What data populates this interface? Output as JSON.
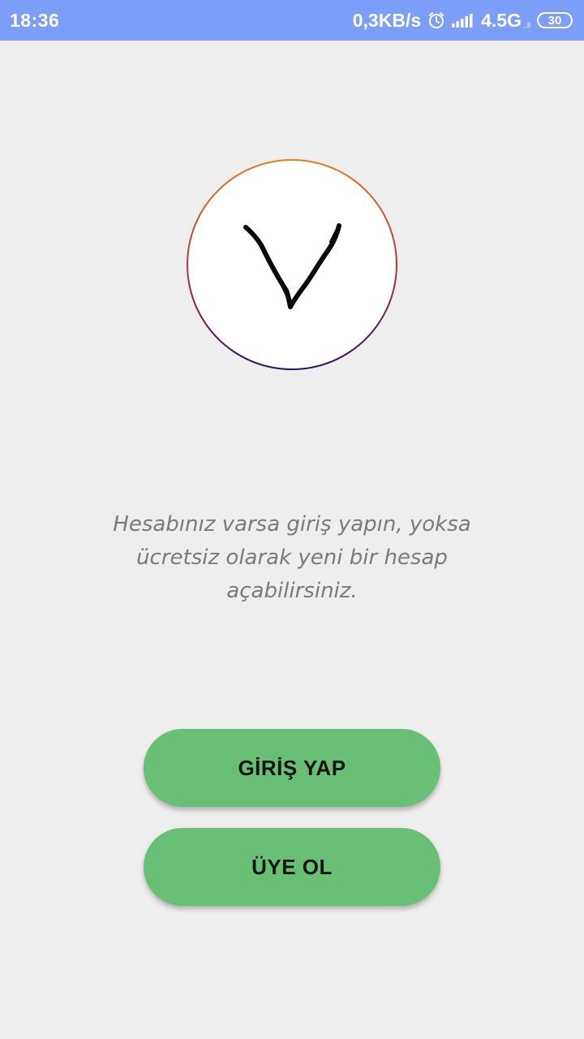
{
  "status_bar": {
    "time": "18:36",
    "network_speed": "0,3KB/s",
    "alarm_icon": "alarm-icon",
    "signal_icon": "signal-bars-icon",
    "network_type": "4.5G",
    "network_sub": "..ll",
    "battery": "30",
    "background_color": "#7b9ff9"
  },
  "logo": {
    "icon": "hand-drawn-v-logo",
    "ring_colors": [
      "#e87f1e",
      "#2c0d5e"
    ]
  },
  "message": "Hesabınız varsa giriş yapın, yoksa ücretsiz olarak yeni bir hesap açabilirsiniz.",
  "buttons": {
    "login_label": "GİRİŞ YAP",
    "register_label": "ÜYE OL",
    "color": "#69bf73"
  }
}
